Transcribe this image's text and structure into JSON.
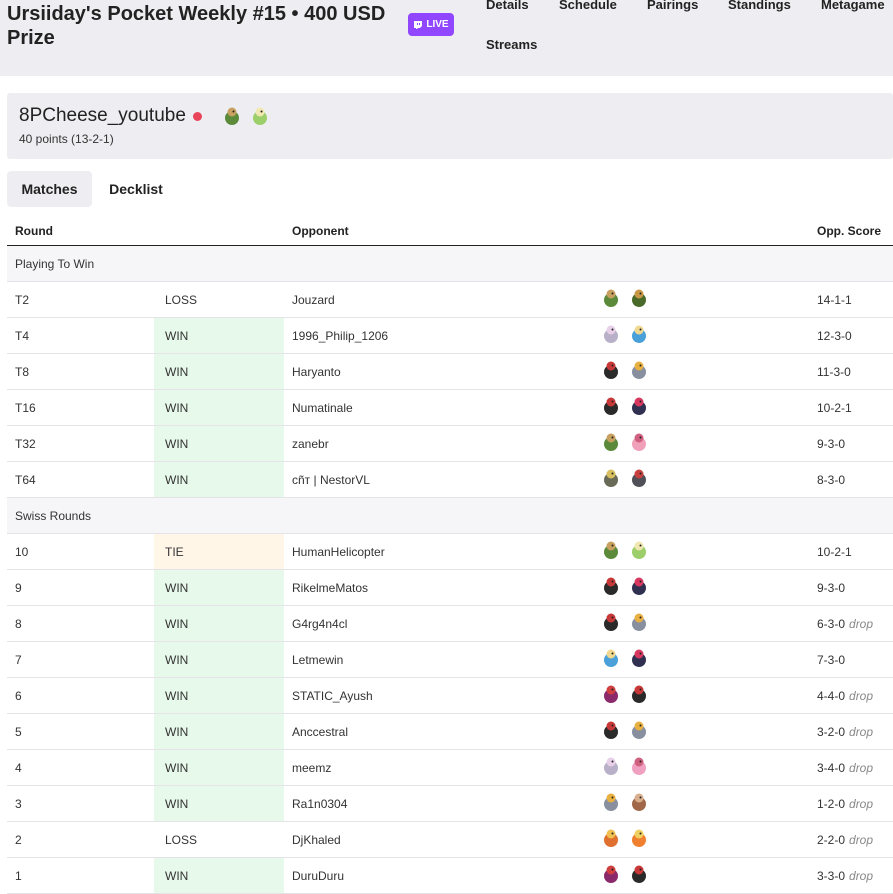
{
  "header": {
    "title": "Ursiiday's Pocket Weekly #15 • 400 USD Prize",
    "live_label": "LIVE",
    "nav": [
      "Details",
      "Schedule",
      "Pairings",
      "Standings",
      "Metagame",
      "Streams"
    ]
  },
  "player": {
    "name": "8PCheese_youtube",
    "points": "40 points (13-2-1)",
    "sprites": [
      "exeggutor-alola",
      "celebi"
    ]
  },
  "tabs": {
    "matches": "Matches",
    "decklist": "Decklist"
  },
  "table": {
    "headers": {
      "round": "Round",
      "opponent": "Opponent",
      "score": "Opp. Score"
    },
    "sections": [
      {
        "label": "Playing To Win",
        "rows": [
          {
            "round": "T2",
            "result": "LOSS",
            "opponent": "Jouzard",
            "score": "14-1-1",
            "drop": "",
            "sprites": [
              "exeggutor",
              "dragon"
            ]
          },
          {
            "round": "T4",
            "result": "WIN",
            "opponent": "1996_Philip_1206",
            "score": "12-3-0",
            "drop": "",
            "sprites": [
              "palkia",
              "water"
            ]
          },
          {
            "round": "T8",
            "result": "WIN",
            "opponent": "Haryanto",
            "score": "11-3-0",
            "drop": "",
            "sprites": [
              "darkrai",
              "magnezone"
            ]
          },
          {
            "round": "T16",
            "result": "WIN",
            "opponent": "Numatinale",
            "score": "10-2-1",
            "drop": "",
            "sprites": [
              "darkrai",
              "weavile"
            ]
          },
          {
            "round": "T32",
            "result": "WIN",
            "opponent": "zanebr",
            "score": "9-3-0",
            "drop": "",
            "sprites": [
              "exeggutor",
              "mew"
            ]
          },
          {
            "round": "T64",
            "result": "WIN",
            "opponent": "cñт | NestorVL",
            "score": "8-3-0",
            "drop": "",
            "sprites": [
              "rock",
              "bird"
            ]
          }
        ]
      },
      {
        "label": "Swiss Rounds",
        "rows": [
          {
            "round": "10",
            "result": "TIE",
            "opponent": "HumanHelicopter",
            "score": "10-2-1",
            "drop": "",
            "sprites": [
              "exeggutor",
              "celebi"
            ]
          },
          {
            "round": "9",
            "result": "WIN",
            "opponent": "RikelmeMatos",
            "score": "9-3-0",
            "drop": "",
            "sprites": [
              "darkrai",
              "weavile"
            ]
          },
          {
            "round": "8",
            "result": "WIN",
            "opponent": "G4rg4n4cl",
            "score": "6-3-0",
            "drop": "drop",
            "sprites": [
              "darkrai",
              "magnezone"
            ]
          },
          {
            "round": "7",
            "result": "WIN",
            "opponent": "Letmewin",
            "score": "7-3-0",
            "drop": "",
            "sprites": [
              "water",
              "weavile"
            ]
          },
          {
            "round": "6",
            "result": "WIN",
            "opponent": "STATIC_Ayush",
            "score": "4-4-0",
            "drop": "drop",
            "sprites": [
              "poison",
              "darkrai"
            ]
          },
          {
            "round": "5",
            "result": "WIN",
            "opponent": "Anccestral",
            "score": "3-2-0",
            "drop": "drop",
            "sprites": [
              "darkrai",
              "magnezone"
            ]
          },
          {
            "round": "4",
            "result": "WIN",
            "opponent": "meemz",
            "score": "3-4-0",
            "drop": "drop",
            "sprites": [
              "palkia",
              "pink"
            ]
          },
          {
            "round": "3",
            "result": "WIN",
            "opponent": "Ra1n0304",
            "score": "1-2-0",
            "drop": "drop",
            "sprites": [
              "magnezone",
              "ground"
            ]
          },
          {
            "round": "2",
            "result": "LOSS",
            "opponent": "DjKhaled",
            "score": "2-2-0",
            "drop": "drop",
            "sprites": [
              "fire",
              "fire-bird"
            ]
          },
          {
            "round": "1",
            "result": "WIN",
            "opponent": "DuruDuru",
            "score": "3-3-0",
            "drop": "drop",
            "sprites": [
              "poison",
              "darkrai"
            ]
          }
        ]
      }
    ]
  },
  "colors": {
    "live": "#9147ff",
    "win_bg": "#e6f9ea",
    "tie_bg": "#fff6e8",
    "header_bg": "#eeeef2",
    "flag": "#e8455a"
  }
}
